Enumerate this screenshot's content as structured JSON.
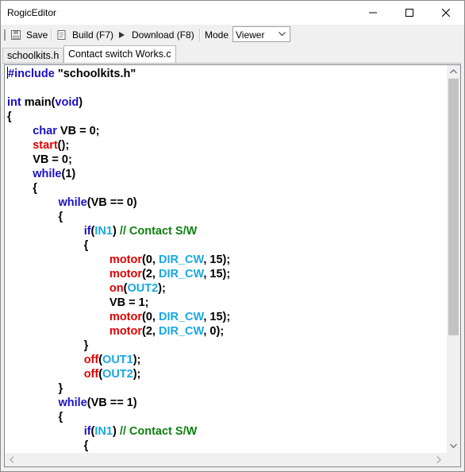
{
  "window": {
    "title": "RogicEditor"
  },
  "toolbar": {
    "save_label": "Save",
    "build_label": "Build (F7)",
    "download_label": "Download (F8)",
    "mode_label": "Mode",
    "mode_value": "Viewer"
  },
  "tabs": [
    {
      "label": "schoolkits.h",
      "active": false
    },
    {
      "label": "Contact switch Works.c",
      "active": true
    }
  ],
  "colors": {
    "keyword": "#1a10c8",
    "function": "#e00000",
    "constant": "#18a8e0",
    "comment": "#108010"
  },
  "code": {
    "lines": [
      [
        {
          "t": "#include",
          "c": "kw"
        },
        {
          "t": " \"schoolkits.h\"",
          "c": "pl"
        }
      ],
      [],
      [
        {
          "t": "int",
          "c": "kw"
        },
        {
          "t": " main(",
          "c": "pl"
        },
        {
          "t": "void",
          "c": "kw"
        },
        {
          "t": ")",
          "c": "pl"
        }
      ],
      [
        {
          "t": "{",
          "c": "pl"
        }
      ],
      [
        {
          "t": "        ",
          "c": "pl"
        },
        {
          "t": "char",
          "c": "kw"
        },
        {
          "t": " VB = 0;",
          "c": "pl"
        }
      ],
      [
        {
          "t": "        ",
          "c": "pl"
        },
        {
          "t": "start",
          "c": "fn"
        },
        {
          "t": "();",
          "c": "pl"
        }
      ],
      [
        {
          "t": "        VB = 0;",
          "c": "pl"
        }
      ],
      [
        {
          "t": "        ",
          "c": "pl"
        },
        {
          "t": "while",
          "c": "kw"
        },
        {
          "t": "(1)",
          "c": "pl"
        }
      ],
      [
        {
          "t": "        {",
          "c": "pl"
        }
      ],
      [
        {
          "t": "                ",
          "c": "pl"
        },
        {
          "t": "while",
          "c": "kw"
        },
        {
          "t": "(VB == 0)",
          "c": "pl"
        }
      ],
      [
        {
          "t": "                {",
          "c": "pl"
        }
      ],
      [
        {
          "t": "                        ",
          "c": "pl"
        },
        {
          "t": "if",
          "c": "kw"
        },
        {
          "t": "(",
          "c": "pl"
        },
        {
          "t": "IN1",
          "c": "cn"
        },
        {
          "t": ") ",
          "c": "pl"
        },
        {
          "t": "// Contact S/W",
          "c": "cm"
        }
      ],
      [
        {
          "t": "                        {",
          "c": "pl"
        }
      ],
      [
        {
          "t": "                                ",
          "c": "pl"
        },
        {
          "t": "motor",
          "c": "fn"
        },
        {
          "t": "(0, ",
          "c": "pl"
        },
        {
          "t": "DIR_CW",
          "c": "cn"
        },
        {
          "t": ", 15);",
          "c": "pl"
        }
      ],
      [
        {
          "t": "                                ",
          "c": "pl"
        },
        {
          "t": "motor",
          "c": "fn"
        },
        {
          "t": "(2, ",
          "c": "pl"
        },
        {
          "t": "DIR_CW",
          "c": "cn"
        },
        {
          "t": ", 15);",
          "c": "pl"
        }
      ],
      [
        {
          "t": "                                ",
          "c": "pl"
        },
        {
          "t": "on",
          "c": "fn"
        },
        {
          "t": "(",
          "c": "pl"
        },
        {
          "t": "OUT2",
          "c": "cn"
        },
        {
          "t": ");",
          "c": "pl"
        }
      ],
      [
        {
          "t": "                                VB = 1;",
          "c": "pl"
        }
      ],
      [
        {
          "t": "                                ",
          "c": "pl"
        },
        {
          "t": "motor",
          "c": "fn"
        },
        {
          "t": "(0, ",
          "c": "pl"
        },
        {
          "t": "DIR_CW",
          "c": "cn"
        },
        {
          "t": ", 15);",
          "c": "pl"
        }
      ],
      [
        {
          "t": "                                ",
          "c": "pl"
        },
        {
          "t": "motor",
          "c": "fn"
        },
        {
          "t": "(2, ",
          "c": "pl"
        },
        {
          "t": "DIR_CW",
          "c": "cn"
        },
        {
          "t": ", 0);",
          "c": "pl"
        }
      ],
      [
        {
          "t": "                        }",
          "c": "pl"
        }
      ],
      [
        {
          "t": "                        ",
          "c": "pl"
        },
        {
          "t": "off",
          "c": "fn"
        },
        {
          "t": "(",
          "c": "pl"
        },
        {
          "t": "OUT1",
          "c": "cn"
        },
        {
          "t": ");",
          "c": "pl"
        }
      ],
      [
        {
          "t": "                        ",
          "c": "pl"
        },
        {
          "t": "off",
          "c": "fn"
        },
        {
          "t": "(",
          "c": "pl"
        },
        {
          "t": "OUT2",
          "c": "cn"
        },
        {
          "t": ");",
          "c": "pl"
        }
      ],
      [
        {
          "t": "                }",
          "c": "pl"
        }
      ],
      [
        {
          "t": "                ",
          "c": "pl"
        },
        {
          "t": "while",
          "c": "kw"
        },
        {
          "t": "(VB == 1)",
          "c": "pl"
        }
      ],
      [
        {
          "t": "                {",
          "c": "pl"
        }
      ],
      [
        {
          "t": "                        ",
          "c": "pl"
        },
        {
          "t": "if",
          "c": "kw"
        },
        {
          "t": "(",
          "c": "pl"
        },
        {
          "t": "IN1",
          "c": "cn"
        },
        {
          "t": ") ",
          "c": "pl"
        },
        {
          "t": "// Contact S/W",
          "c": "cm"
        }
      ],
      [
        {
          "t": "                        {",
          "c": "pl"
        }
      ]
    ]
  }
}
